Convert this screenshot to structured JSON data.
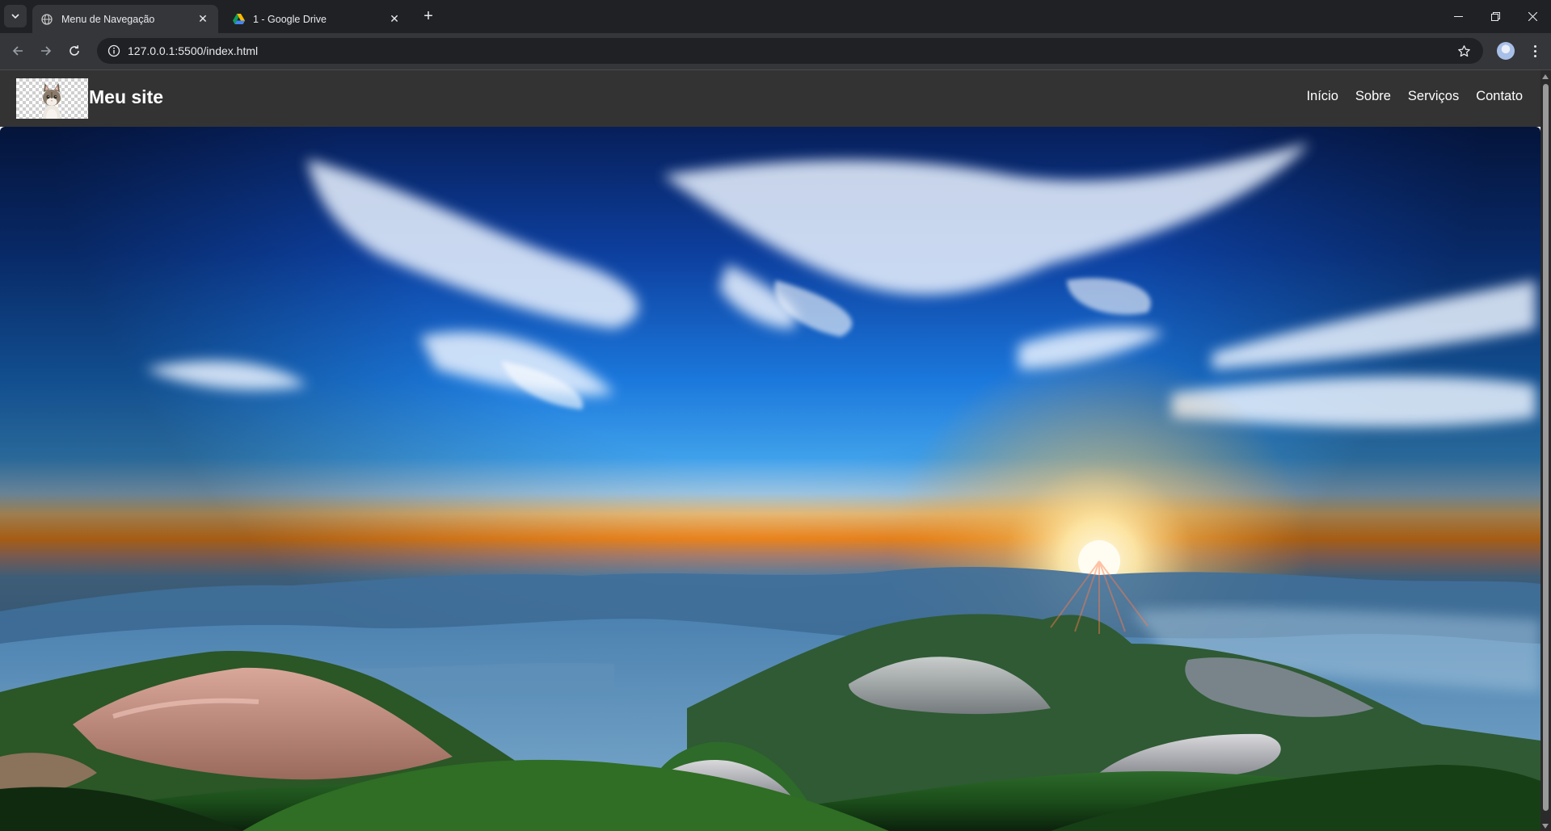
{
  "browser": {
    "tabs": [
      {
        "title": "Menu de Navegação",
        "active": true,
        "favicon": "globe-icon"
      },
      {
        "title": "1 - Google Drive",
        "active": false,
        "favicon": "google-drive-icon"
      }
    ],
    "url": "127.0.0.1:5500/index.html"
  },
  "site": {
    "title": "Meu site",
    "logo": "cat-logo-image",
    "nav": [
      "Início",
      "Sobre",
      "Serviços",
      "Contato"
    ]
  },
  "hero": {
    "image": "mountain-sunrise-landscape",
    "colors": {
      "sky_top": "#0a2a6e",
      "sky_mid": "#1c7fe0",
      "horizon": "#ff9a1a",
      "sun": "#fff6d5",
      "mist": "#7fb1d6",
      "forest": "#1f5a1f"
    }
  },
  "header_bg": "#333333"
}
